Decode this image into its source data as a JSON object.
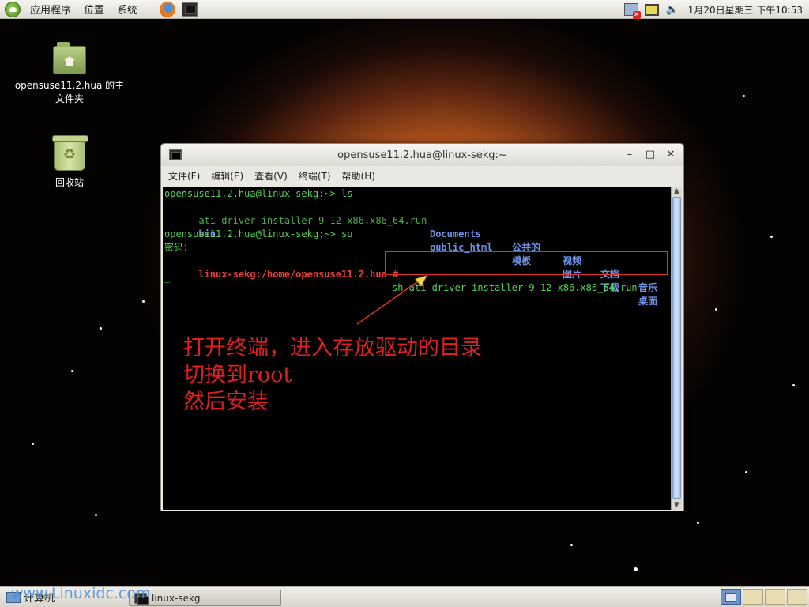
{
  "top_panel": {
    "menus": [
      "应用程序",
      "位置",
      "系统"
    ],
    "clock": "1月20日星期三 下午10:53"
  },
  "desktop": {
    "home_folder_label": "opensuse11.2.hua 的主文件夹",
    "trash_label": "回收站"
  },
  "window": {
    "title": "opensuse11.2.hua@linux-sekg:~",
    "menus": [
      "文件(F)",
      "编辑(E)",
      "查看(V)",
      "终端(T)",
      "帮助(H)"
    ],
    "terminal": {
      "prompt1": "opensuse11.2.hua@linux-sekg:~> ls",
      "ls_file1": "ati-driver-installer-9-12-x86.x86_64.run",
      "ls_dir1": "bin",
      "ls_row1": [
        "Documents",
        "公共的",
        "视频",
        "文档",
        "音乐"
      ],
      "ls_row2": [
        "public_html",
        "模板",
        "图片",
        "下载",
        "桌面"
      ],
      "prompt2": "opensuse11.2.hua@linux-sekg:~> su",
      "password_prompt": "密码：",
      "root_prompt": "linux-sekg:/home/opensuse11.2.hua #",
      "root_command": "sh ati-driver-installer-9-12-x86.x86_64.run",
      "cursor": "_"
    },
    "annotation": [
      "打开终端，进入存放驱动的目录",
      "切换到root",
      "然后安装"
    ]
  },
  "bottom_panel": {
    "computer_label": "计算机",
    "task_label": "linux-sekg",
    "watermark": "www.Linuxidc.com"
  },
  "colors": {
    "prompt_green": "#55d455",
    "dir_blue": "#6f93e6",
    "root_red": "#e84040",
    "annotation_red": "#e02020"
  }
}
